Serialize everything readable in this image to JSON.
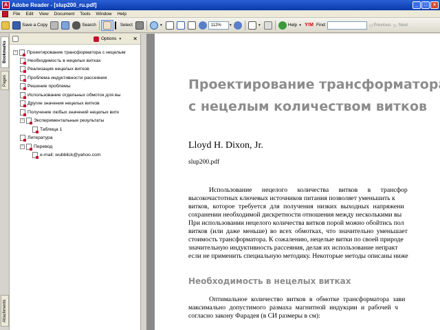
{
  "window": {
    "title": "Adobe Reader - [slup200_ru.pdf]",
    "app_icon": "adobe-reader-icon"
  },
  "menu": [
    "File",
    "Edit",
    "View",
    "Document",
    "Tools",
    "Window",
    "Help"
  ],
  "toolbar": {
    "save_copy": "Save a Copy",
    "search": "Search",
    "select": "Select",
    "zoom_value": "112%",
    "help": "Help",
    "find_label": "Find:",
    "find_value": "",
    "previous": "Previous",
    "next": "Next"
  },
  "side_tabs": {
    "bookmarks": "Bookmarks",
    "pages": "Pages",
    "attachments": "Attachments"
  },
  "panel": {
    "options": "Options"
  },
  "bookmarks": [
    "Проектирование трансформатора с нецелым",
    "Необходимость в нецелых витках",
    "Реализация нецелых витков",
    "Проблема индуктивности рассеяния",
    "Решение проблемы",
    "Использование отдельных обмоток для вы",
    "Другие значения нецелых витков",
    "Получение любых значений нецелых витк",
    "Экспериментальные результаты",
    "Таблица 1",
    "Литература",
    "Перевод",
    "e-mail: wubblick@yahoo.com"
  ],
  "document": {
    "title_line1": "Проектирование трансформатора",
    "title_line2": "с нецелым количеством витков",
    "author": "Lloyd H. Dixon, Jr.",
    "filename": "slup200.pdf",
    "para1": [
      "Использование нецелого количества витков в трансфор",
      "высокочастотных ключевых источников питания позволяет уменьшить к",
      "витков, которое требуется для получения низких выходных напряжени",
      "сохранении необходимой дискретности отношения между несколькими вы",
      "При использовании нецелого количества витков порой можно обойтись пол",
      "витков (или даже меньше) во всех обмотках, что значительно уменьшает",
      "стоимость трансформатора. К сожалению, нецелые витки по своей природе",
      "значительную индуктивность рассеяния, делая их использование непракт",
      "если не применить специальную методику. Некоторые методы описаны ниже"
    ],
    "section_heading": "Необходимость в нецелых витках",
    "para2": [
      "Оптимальное количество витков в обмотке трансформатора зави",
      "максимально допустимого размаха магнитной индукции и рабочей ч",
      "согласно закону Фарадея (в СИ размеры в см):"
    ]
  }
}
